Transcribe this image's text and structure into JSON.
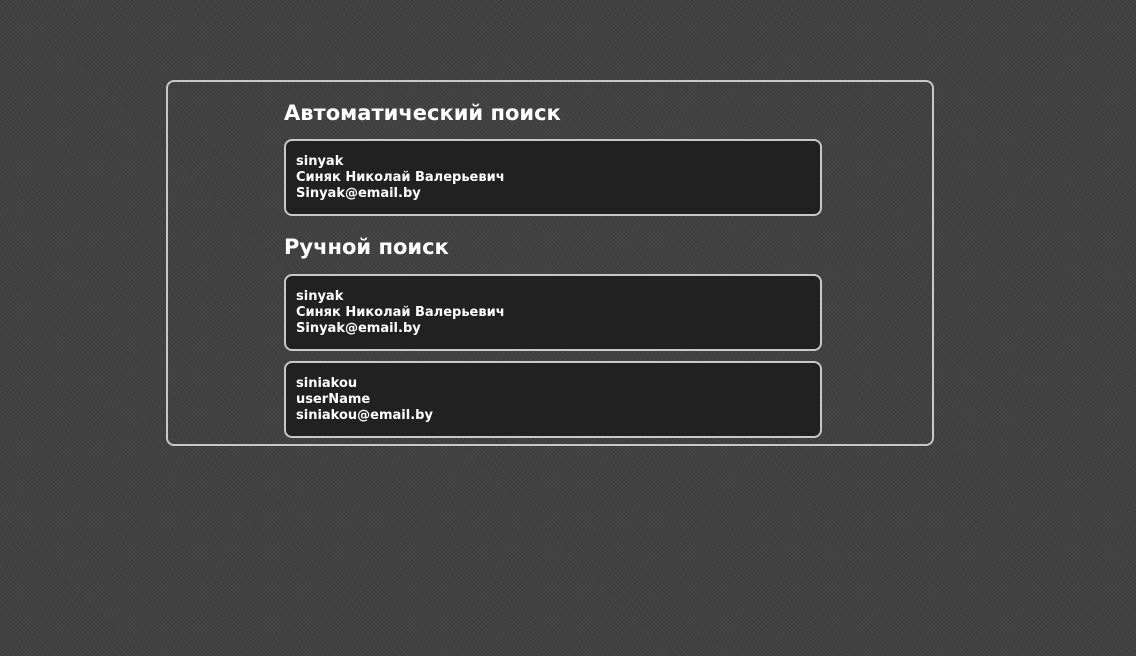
{
  "auto_search": {
    "title": "Автоматический поиск",
    "results": [
      {
        "login": "sinyak",
        "full_name": "Синяк Николай Валерьевич",
        "email": "Sinyak@email.by"
      }
    ]
  },
  "manual_search": {
    "title": "Ручной поиск",
    "results": [
      {
        "login": "sinyak",
        "full_name": "Синяк Николай Валерьевич",
        "email": "Sinyak@email.by"
      },
      {
        "login": "siniakou",
        "full_name": "userName",
        "email": "siniakou@email.by"
      }
    ]
  }
}
